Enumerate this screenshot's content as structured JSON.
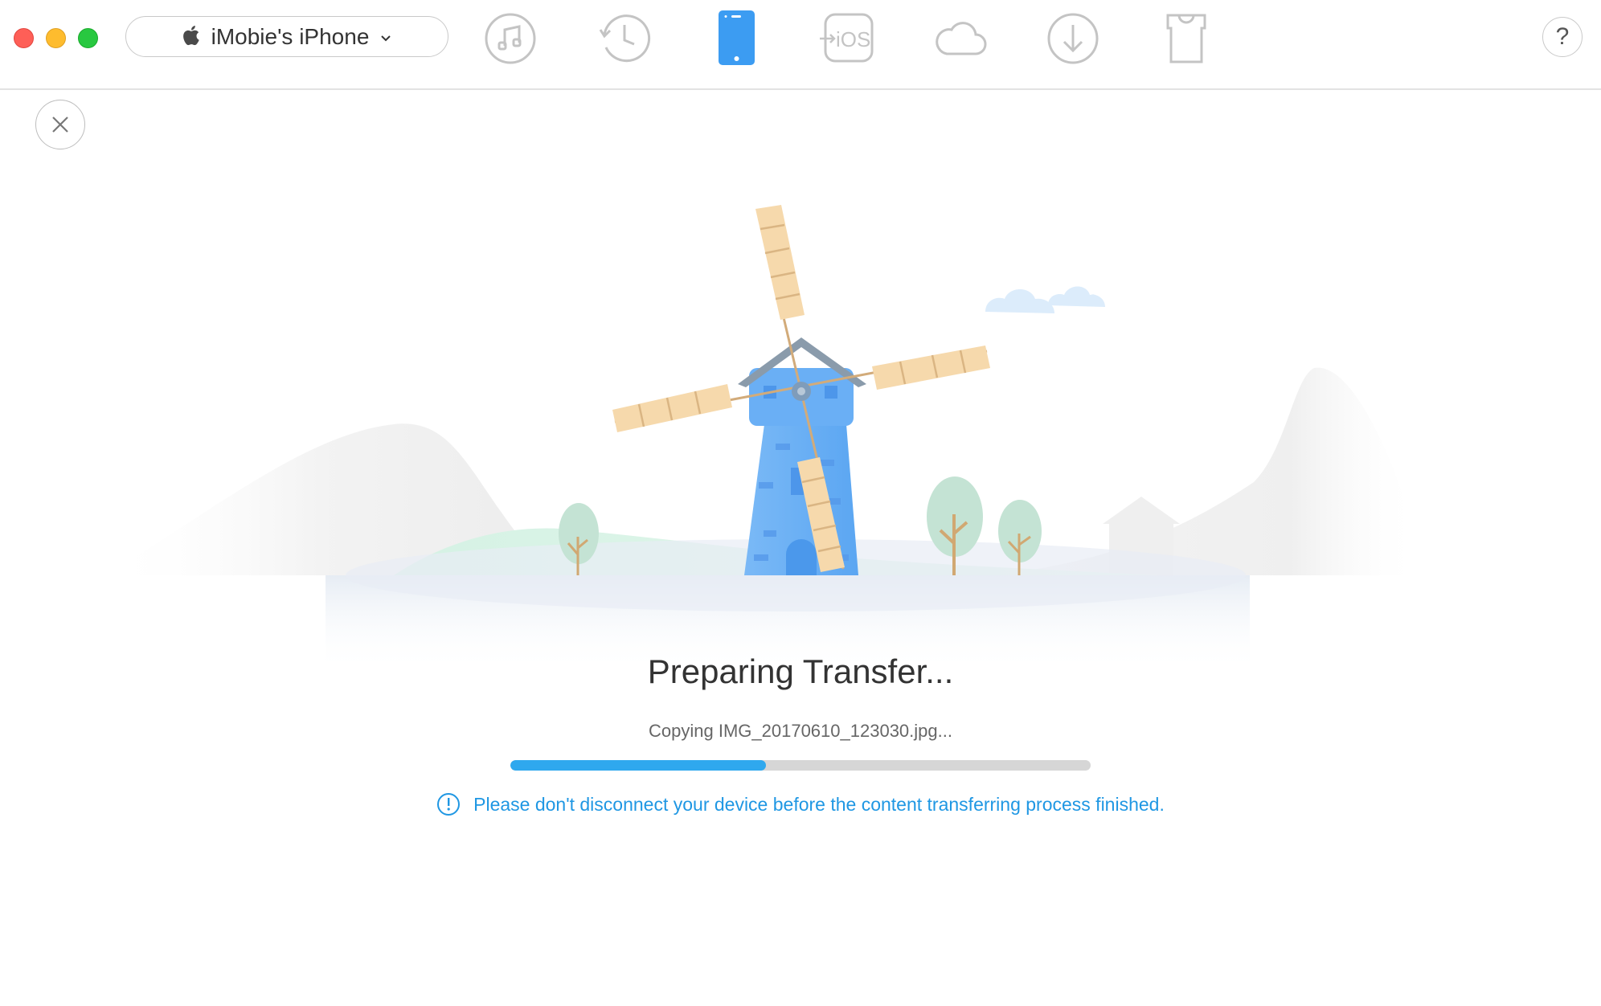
{
  "toolbar": {
    "device_name": "iMobie's iPhone",
    "icons": [
      {
        "name": "music-icon",
        "active": false
      },
      {
        "name": "backup-history-icon",
        "active": false
      },
      {
        "name": "device-manager-icon",
        "active": true
      },
      {
        "name": "ios-mover-icon",
        "active": false,
        "label": "iOS"
      },
      {
        "name": "icloud-icon",
        "active": false
      },
      {
        "name": "download-icon",
        "active": false
      },
      {
        "name": "skin-icon",
        "active": false
      }
    ],
    "help_label": "?"
  },
  "transfer": {
    "title": "Preparing Transfer...",
    "status": "Copying IMG_20170610_123030.jpg...",
    "progress": 0.44,
    "notice": "Please don't disconnect your device before the content transferring process finished."
  },
  "colors": {
    "accent": "#2fa8ee",
    "notice": "#1f97e3",
    "active_icon": "#3c9cf2",
    "inactive_icon": "#c4c4c4",
    "windmill_body": "#64aef5",
    "windmill_blade": "#f6d9ac"
  }
}
